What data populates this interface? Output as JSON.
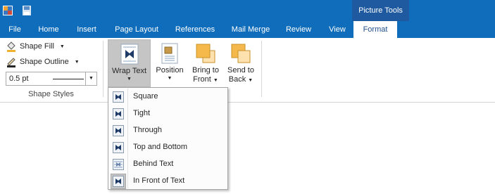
{
  "quick_access": {
    "app_icon": "word-app-icon",
    "save_icon": "save-icon"
  },
  "context_tab": {
    "label": "Picture Tools"
  },
  "tabs": [
    {
      "label": "File"
    },
    {
      "label": "Home"
    },
    {
      "label": "Insert"
    },
    {
      "label": "Page Layout"
    },
    {
      "label": "References"
    },
    {
      "label": "Mail Merge"
    },
    {
      "label": "Review"
    },
    {
      "label": "View"
    },
    {
      "label": "Format",
      "active": true
    }
  ],
  "shape_styles": {
    "shape_fill": "Shape Fill",
    "shape_outline": "Shape Outline",
    "outline_weight": "0.5 pt",
    "group_label": "Shape Styles"
  },
  "arrange": {
    "wrap_text": "Wrap Text",
    "position": "Position",
    "bring_to_front_line1": "Bring to",
    "bring_to_front_line2": "Front",
    "send_to_back_line1": "Send to",
    "send_to_back_line2": "Back"
  },
  "wrap_menu": {
    "items": [
      {
        "label": "Square",
        "icon": "wrap-square-icon"
      },
      {
        "label": "Tight",
        "icon": "wrap-tight-icon"
      },
      {
        "label": "Through",
        "icon": "wrap-through-icon"
      },
      {
        "label": "Top and Bottom",
        "icon": "wrap-top-bottom-icon"
      },
      {
        "label": "Behind Text",
        "icon": "wrap-behind-text-icon"
      },
      {
        "label": "In Front of Text",
        "icon": "wrap-in-front-icon",
        "checked": true
      }
    ]
  },
  "colors": {
    "title_bar": "#0f6dbb",
    "context_tab": "#1f5aa0",
    "active_tab_text": "#1f4e8c",
    "pressed_button": "#c5c5c5"
  }
}
